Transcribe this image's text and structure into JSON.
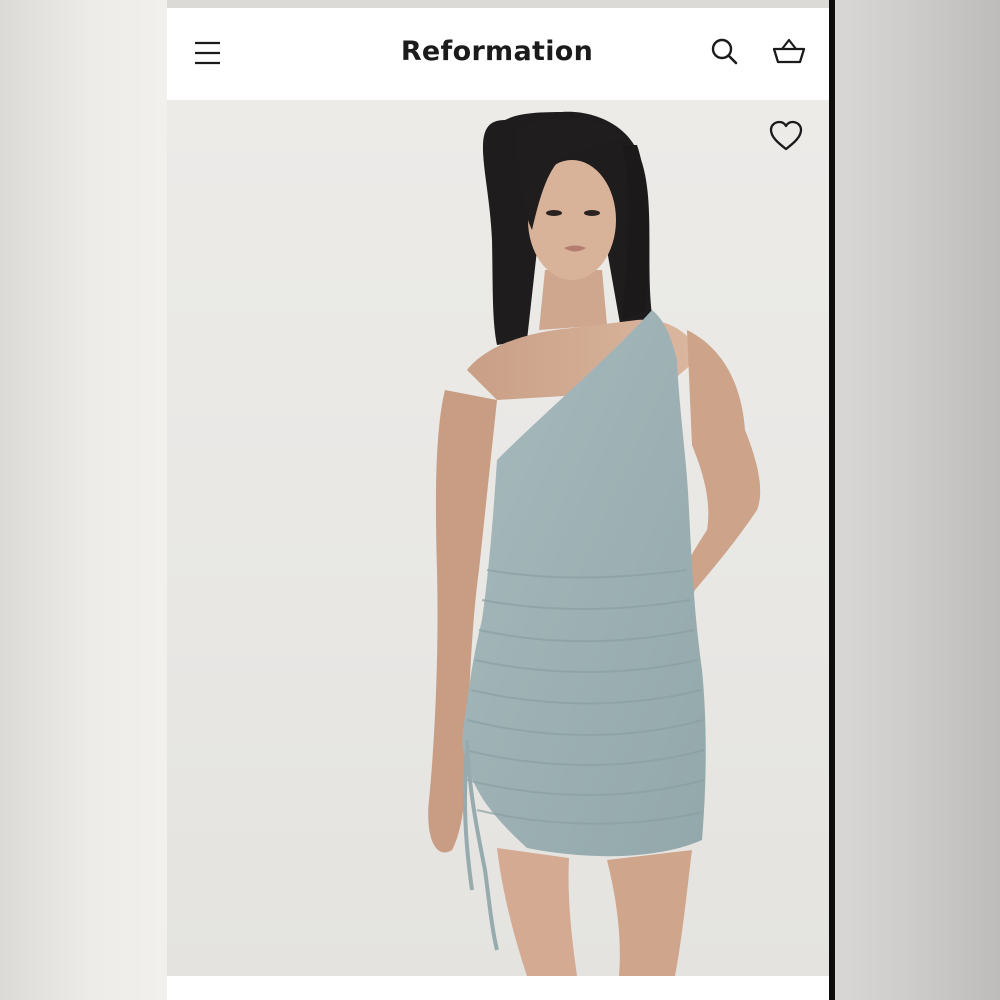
{
  "header": {
    "brand": "Reformation",
    "menu_icon": "hamburger-menu-icon",
    "search_icon": "search-icon",
    "cart_icon": "shopping-basket-icon"
  },
  "product": {
    "image_alt": "",
    "favorite_icon": "heart-outline-icon"
  },
  "colors": {
    "header_bg": "#ffffff",
    "brand_text": "#1b1b1b",
    "dress": "#9fb3b6",
    "image_bg": "#ebeae7"
  }
}
